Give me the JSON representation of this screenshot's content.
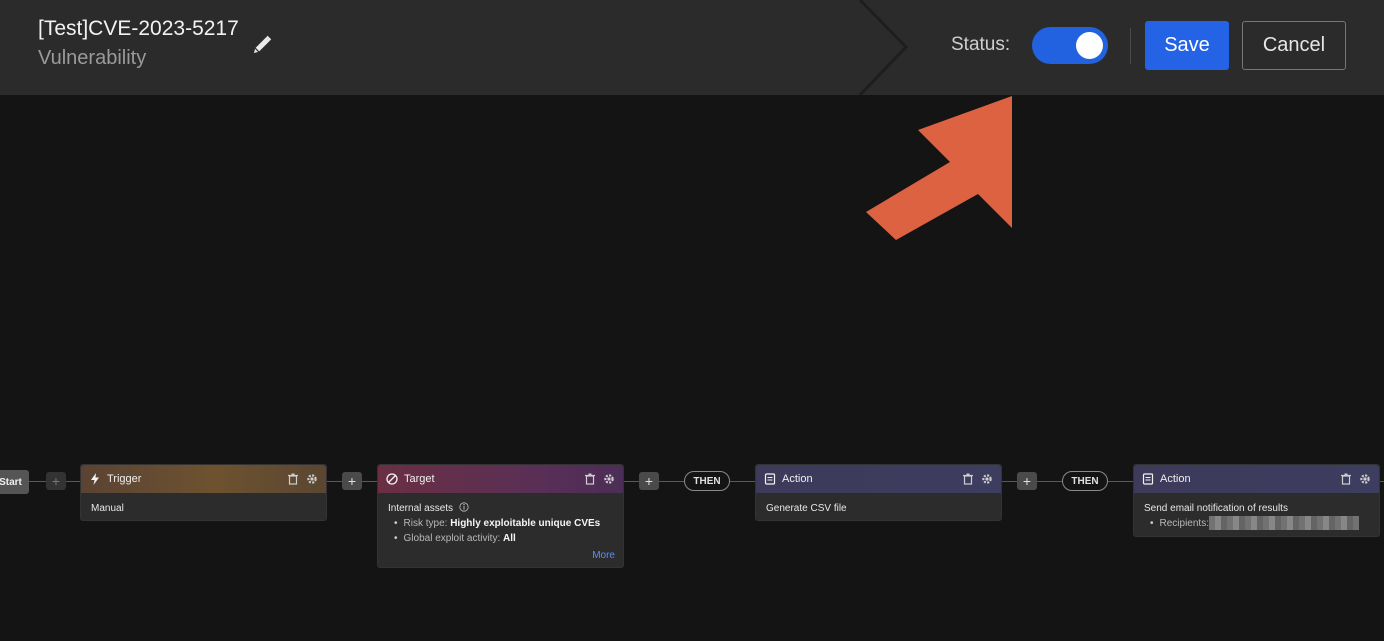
{
  "header": {
    "title": "[Test]CVE-2023-5217",
    "subtitle": "Vulnerability",
    "status_label": "Status:",
    "status_on": true,
    "save_label": "Save",
    "cancel_label": "Cancel",
    "accent_color": "#2563e6"
  },
  "annotation": {
    "arrow_color": "#e06040",
    "icon": "arrow-up-right-icon"
  },
  "flow": {
    "start_label": "Start",
    "plus_label": "+",
    "then_label": "THEN",
    "nodes": [
      {
        "kind": "Trigger",
        "icon": "lightning-icon",
        "body": "Manual"
      },
      {
        "kind": "Target",
        "icon": "target-icon",
        "title": "Internal assets",
        "info_icon": "info-icon",
        "items": [
          {
            "label": "Risk type:",
            "value": "Highly exploitable unique CVEs"
          },
          {
            "label": "Global exploit activity:",
            "value": "All"
          }
        ],
        "more": "More"
      },
      {
        "kind": "Action",
        "icon": "document-icon",
        "body": "Generate CSV file"
      },
      {
        "kind": "Action",
        "icon": "document-icon",
        "body": "Send email notification of results",
        "items": [
          {
            "label": "Recipients:",
            "value": ""
          }
        ]
      }
    ]
  }
}
